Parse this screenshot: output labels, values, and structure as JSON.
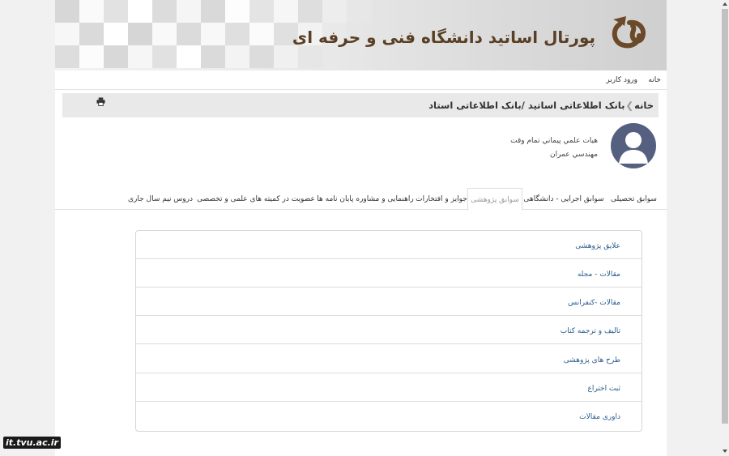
{
  "banner": {
    "title": "پورتال اساتید دانشگاه فنی و حرفه ای"
  },
  "topnav": {
    "home": "خانه",
    "login": "ورود کاربر"
  },
  "breadcrumb": {
    "home": "خانه",
    "path": "بانک اطلاعاتی اساتید /بانک اطلاعاتی استاد",
    "print_icon": "print-icon"
  },
  "profile": {
    "position": "هيات علمي پيماني تمام وقت",
    "department": "مهندسي عمران"
  },
  "tabs": [
    {
      "label": "سوابق تحصیلی"
    },
    {
      "label": "سوابق اجرایی - دانشگاهی"
    },
    {
      "label": "سوابق پژوهشی"
    },
    {
      "label": "جوایز و افتخارات"
    },
    {
      "label": "راهنمایی و مشاوره پایان نامه ها"
    },
    {
      "label": "عضویت در کمیته های علمی و تخصصی"
    },
    {
      "label": "دروس نیم سال جاری"
    }
  ],
  "research_items": [
    {
      "label": "علایق پژوهشی"
    },
    {
      "label": "مقالات - مجله"
    },
    {
      "label": "مقالات -کنفرانس"
    },
    {
      "label": "تالیف و ترجمه کتاب"
    },
    {
      "label": "طرح های پژوهشی"
    },
    {
      "label": "ثبت اختراع"
    },
    {
      "label": "داوری مقالات"
    }
  ],
  "watermark": "it.tvu.ac.ir",
  "colors": {
    "title": "#5a3f25",
    "link": "#2a5b8c",
    "avatar": "#556080"
  }
}
